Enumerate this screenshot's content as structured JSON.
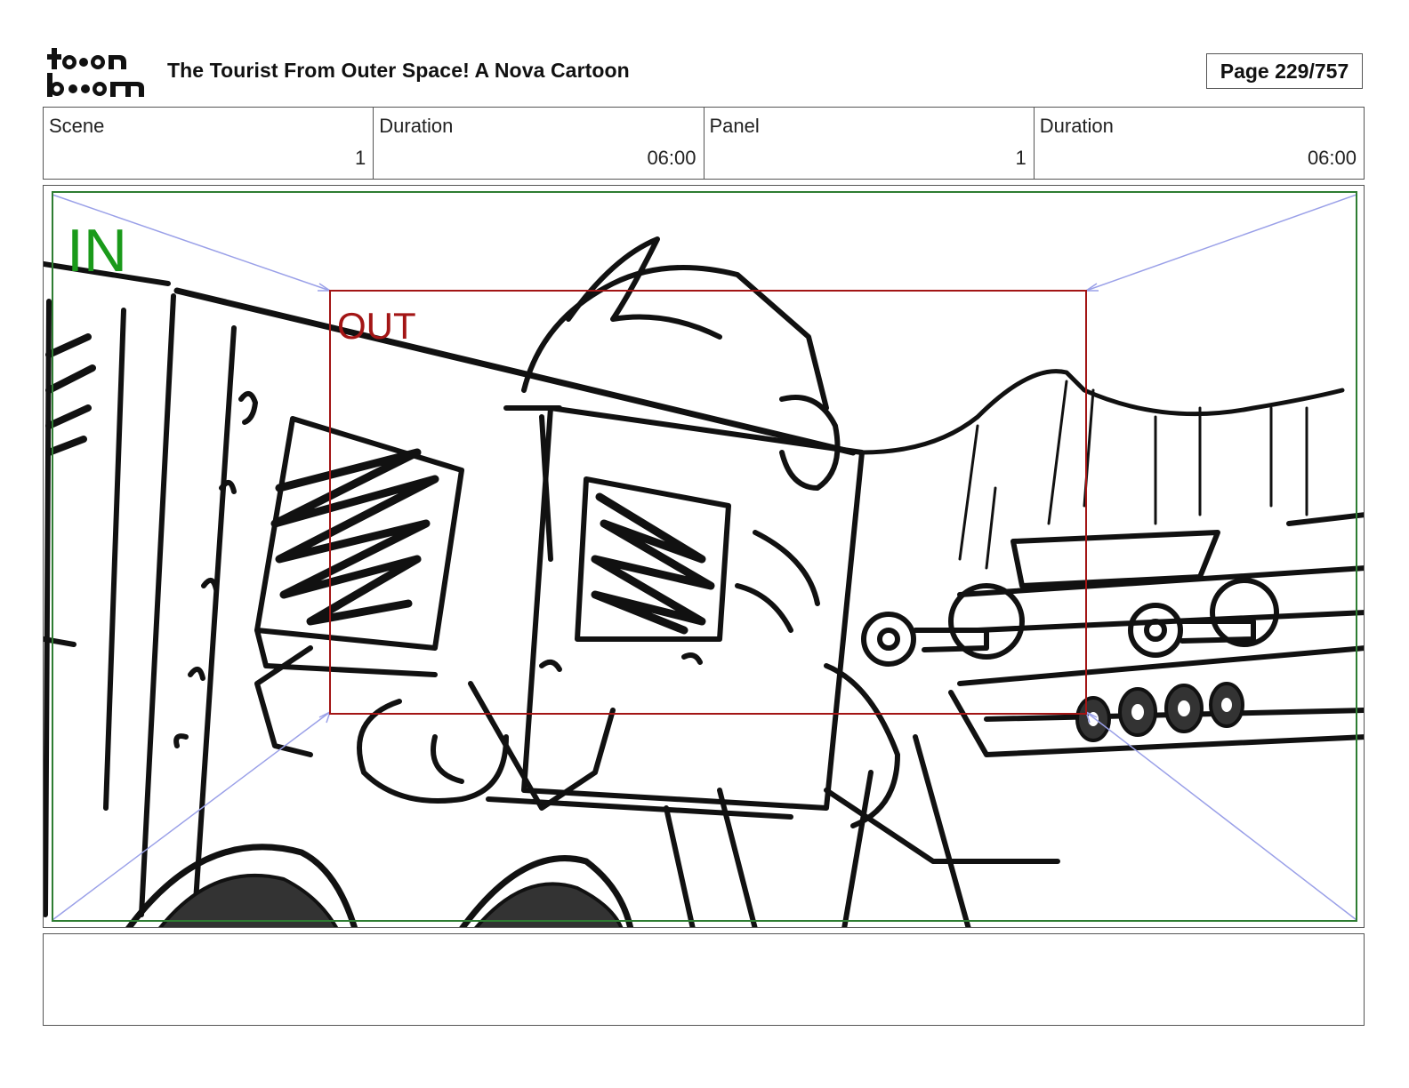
{
  "header": {
    "logo_text_top": "toon",
    "logo_text_bottom": "boom",
    "title": "The Tourist From Outer Space!  A Nova Cartoon",
    "page_label": "Page 229/757"
  },
  "info": [
    {
      "label": "Scene",
      "value": "1"
    },
    {
      "label": "Duration",
      "value": "06:00"
    },
    {
      "label": "Panel",
      "value": "1"
    },
    {
      "label": "Duration",
      "value": "06:00"
    }
  ],
  "panel": {
    "in_label": "IN",
    "out_label": "OUT",
    "in_color": "#1a9a1a",
    "out_color": "#a31515",
    "guide_color": "#9aa0e8"
  },
  "caption": {
    "text": ""
  }
}
